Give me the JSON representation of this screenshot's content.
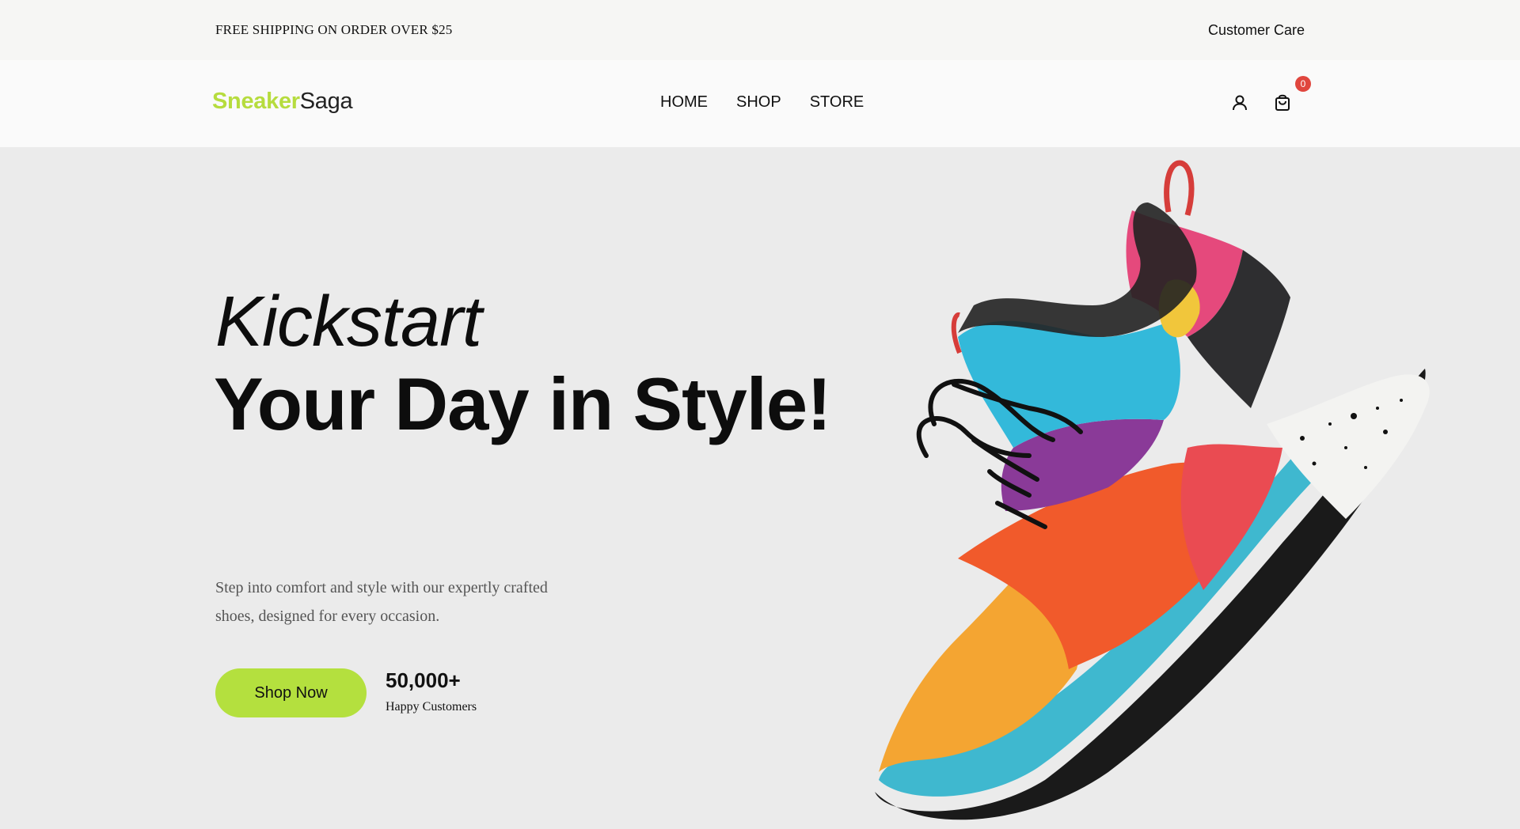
{
  "topbar": {
    "shipping_text": "FREE SHIPPING ON ORDER OVER $25",
    "customer_care": "Customer Care"
  },
  "brand": {
    "part1": "Sneaker",
    "part2": "Saga",
    "accent_color": "#b6dc3e"
  },
  "nav": {
    "items": [
      {
        "label": "HOME"
      },
      {
        "label": "SHOP"
      },
      {
        "label": "STORE"
      }
    ]
  },
  "header_icons": {
    "user": "user-icon",
    "cart": "shopping-bag-icon",
    "cart_count": "0",
    "badge_color": "#e0463e"
  },
  "hero": {
    "headline_line1": "Kickstart",
    "headline_line2": "Your Day in Style!",
    "description": "Step into comfort and style with our expertly crafted shoes, designed for every occasion.",
    "cta_label": "Shop Now",
    "cta_color": "#b4e03e",
    "stat_value": "50,000+",
    "stat_label": "Happy Customers",
    "image": "colorful-sneaker-image"
  }
}
